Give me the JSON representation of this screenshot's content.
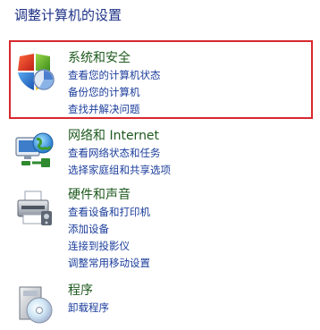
{
  "page": {
    "title": "调整计算机的设置"
  },
  "categories": [
    {
      "title": "系统和安全",
      "icon": "shield-icon",
      "links": [
        "查看您的计算机状态",
        "备份您的计算机",
        "查找并解决问题"
      ]
    },
    {
      "title": "网络和 Internet",
      "icon": "network-globe-icon",
      "links": [
        "查看网络状态和任务",
        "选择家庭组和共享选项"
      ]
    },
    {
      "title": "硬件和声音",
      "icon": "printer-icon",
      "links": [
        "查看设备和打印机",
        "添加设备",
        "连接到投影仪",
        "调整常用移动设置"
      ]
    },
    {
      "title": "程序",
      "icon": "programs-icon",
      "links": [
        "卸载程序"
      ]
    }
  ],
  "colors": {
    "title_text": "#1e3287",
    "category_title": "#1e5a1e",
    "link_text": "#1c3e9c",
    "highlight_border": "#d8272d"
  }
}
